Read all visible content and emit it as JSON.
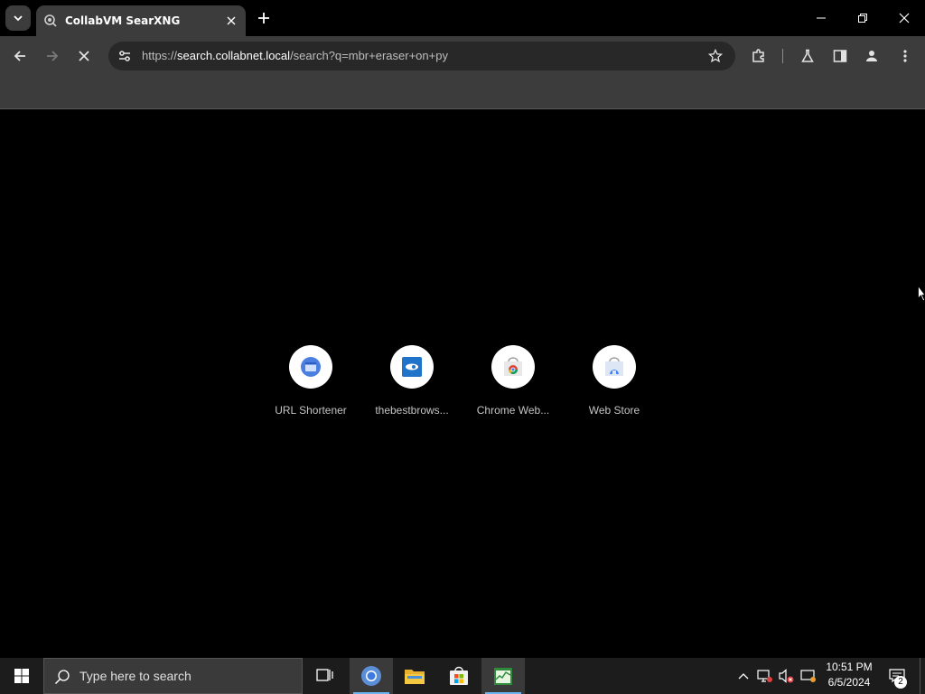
{
  "browser": {
    "tab": {
      "title": "CollabVM SearXNG",
      "favicon": "searxng-icon"
    },
    "address_bar": {
      "url_scheme": "https://",
      "url_host": "search.collabnet.local",
      "url_path": "/search?q=mbr+eraser+on+py"
    },
    "loading": true
  },
  "new_tab_page": {
    "shortcuts": [
      {
        "label": "URL Shortener",
        "icon": "url-shortener-icon"
      },
      {
        "label": "thebestbrows...",
        "icon": "thebestbrowser-icon"
      },
      {
        "label": "Chrome Web...",
        "icon": "chrome-web-store-icon"
      },
      {
        "label": "Web Store",
        "icon": "web-store-icon"
      }
    ]
  },
  "taskbar": {
    "search_placeholder": "Type here to search",
    "apps": [
      {
        "name": "Chrome",
        "active": true
      },
      {
        "name": "File Explorer",
        "active": false
      },
      {
        "name": "Microsoft Store",
        "active": false
      },
      {
        "name": "Task Manager",
        "active": true
      }
    ],
    "clock": {
      "time": "10:51 PM",
      "date": "6/5/2024"
    },
    "notification_count": "2"
  },
  "colors": {
    "chrome_toolbar": "#3c3c3c",
    "omnibox": "#282828",
    "taskbar": "#1c1c1c",
    "accent": "#6cb4f0"
  }
}
